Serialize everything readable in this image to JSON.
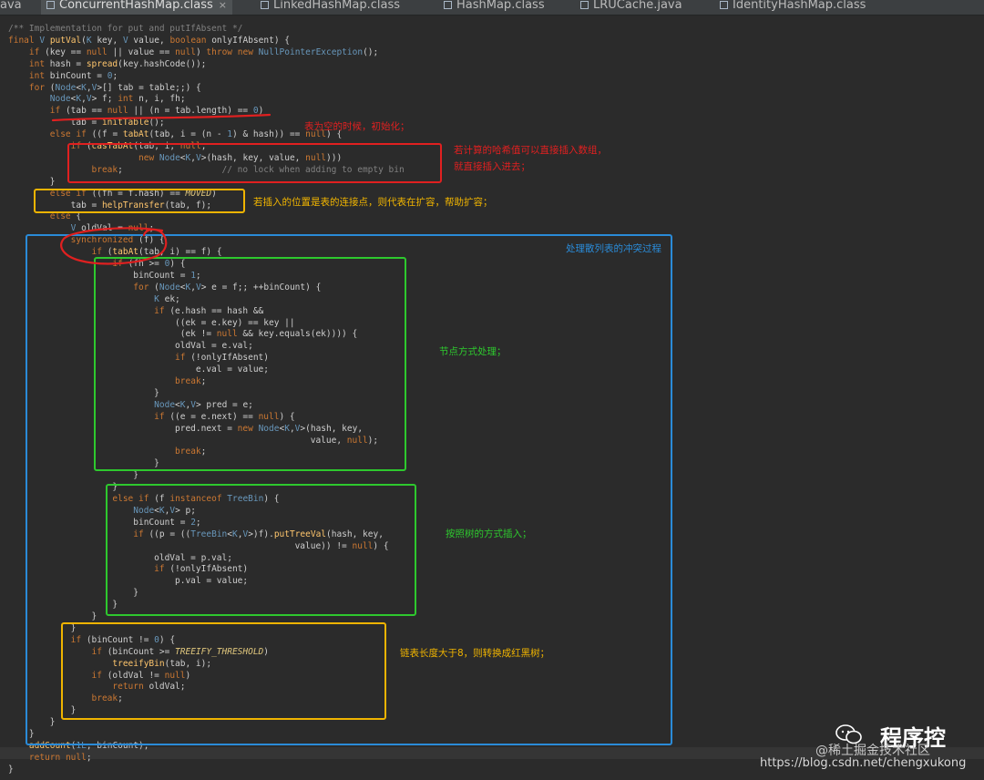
{
  "tabs": [
    {
      "label": "ava",
      "active": false
    },
    {
      "label": "ConcurrentHashMap.class",
      "active": true
    },
    {
      "label": "LinkedHashMap.class",
      "active": false
    },
    {
      "label": "HashMap.class",
      "active": false
    },
    {
      "label": "LRUCache.java",
      "active": false
    },
    {
      "label": "IdentityHashMap.class",
      "active": false
    }
  ],
  "tab_close_glyph": "×",
  "code": [
    "/** Implementation for put and putIfAbsent */",
    "final V putVal(K key, V value, boolean onlyIfAbsent) {",
    "    if (key == null || value == null) throw new NullPointerException();",
    "    int hash = spread(key.hashCode());",
    "    int binCount = 0;",
    "    for (Node<K,V>[] tab = table;;) {",
    "        Node<K,V> f; int n, i, fh;",
    "        if (tab == null || (n = tab.length) == 0)",
    "            tab = initTable();",
    "        else if ((f = tabAt(tab, i = (n - 1) & hash)) == null) {",
    "            if (casTabAt(tab, i, null,",
    "                         new Node<K,V>(hash, key, value, null)))",
    "                break;                   // no lock when adding to empty bin",
    "        }",
    "        else if ((fh = f.hash) == MOVED)",
    "            tab = helpTransfer(tab, f);",
    "        else {",
    "            V oldVal = null;",
    "            synchronized (f) {",
    "                if (tabAt(tab, i) == f) {",
    "                    if (fh >= 0) {",
    "                        binCount = 1;",
    "                        for (Node<K,V> e = f;; ++binCount) {",
    "                            K ek;",
    "                            if (e.hash == hash &&",
    "                                ((ek = e.key) == key ||",
    "                                 (ek != null && key.equals(ek)))) {",
    "                                oldVal = e.val;",
    "                                if (!onlyIfAbsent)",
    "                                    e.val = value;",
    "                                break;",
    "                            }",
    "                            Node<K,V> pred = e;",
    "                            if ((e = e.next) == null) {",
    "                                pred.next = new Node<K,V>(hash, key,",
    "                                                          value, null);",
    "                                break;",
    "                            }",
    "                        }",
    "                    }",
    "                    else if (f instanceof TreeBin) {",
    "                        Node<K,V> p;",
    "                        binCount = 2;",
    "                        if ((p = ((TreeBin<K,V>)f).putTreeVal(hash, key,",
    "                                                       value)) != null) {",
    "                            oldVal = p.val;",
    "                            if (!onlyIfAbsent)",
    "                                p.val = value;",
    "                        }",
    "                    }",
    "                }",
    "            }",
    "            if (binCount != 0) {",
    "                if (binCount >= TREEIFY_THRESHOLD)",
    "                    treeifyBin(tab, i);",
    "                if (oldVal != null)",
    "                    return oldVal;",
    "                break;",
    "            }",
    "        }",
    "    }",
    "    addCount(1L, binCount);",
    "    return null;",
    "}"
  ],
  "annotations": {
    "init": "表为空的时候，初始化；",
    "empty_bin_1": "若计算的哈希值可以直接插入数组，",
    "empty_bin_2": "就直接插入进去；",
    "moved": "若插入的位置是表的连接点，则代表在扩容，帮助扩容；",
    "conflict": "处理散列表的冲突过程",
    "node": "节点方式处理；",
    "tree": "按照树的方式插入；",
    "treeify": "链表长度大于8，则转换成红黑树；"
  },
  "watermark": {
    "brand": "程序控",
    "community": "@稀土掘金技术社区",
    "url": "https://blog.csdn.net/chengxukong"
  },
  "colors": {
    "background": "#2b2b2b",
    "red": "#e02020",
    "yellow": "#f0b400",
    "green": "#2ec82e",
    "blue": "#2a8bd8"
  }
}
